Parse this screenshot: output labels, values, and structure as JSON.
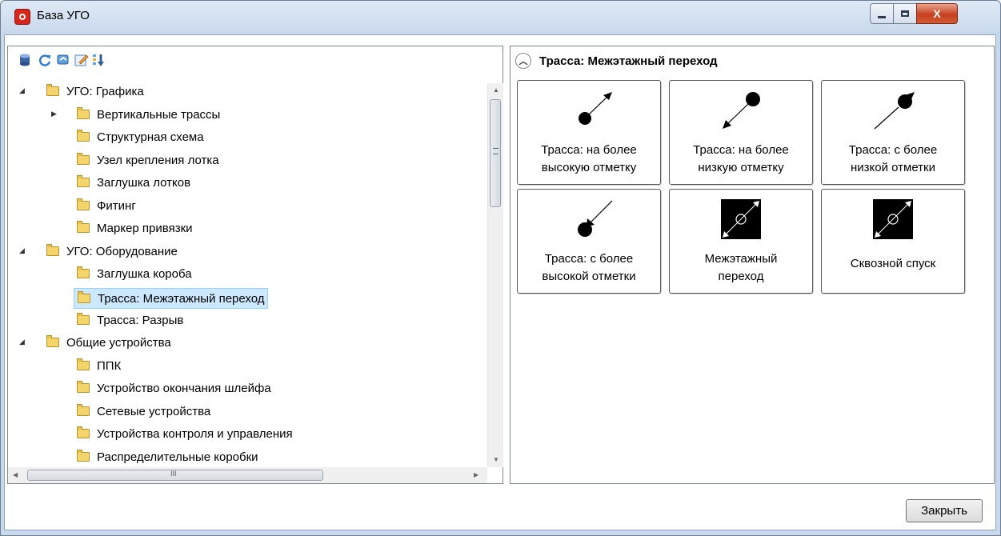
{
  "window": {
    "title": "База УГО",
    "minimize_icon": "minimize-icon",
    "maximize_icon": "maximize-icon",
    "close_glyph": "X"
  },
  "toolbar": {
    "icons": [
      "database-icon",
      "refresh-icon",
      "sync-icon",
      "edit-icon",
      "sort-icon"
    ]
  },
  "tree": {
    "items": [
      {
        "label": "УГО: Графика",
        "level": 0,
        "expanded": true
      },
      {
        "label": "Вертикальные трассы",
        "level": 1,
        "collapsed": true
      },
      {
        "label": "Структурная схема",
        "level": 1
      },
      {
        "label": "Узел крепления лотка",
        "level": 1
      },
      {
        "label": "Заглушка лотков",
        "level": 1
      },
      {
        "label": "Фитинг",
        "level": 1
      },
      {
        "label": "Маркер привязки",
        "level": 1
      },
      {
        "label": "УГО: Оборудование",
        "level": 0,
        "expanded": true
      },
      {
        "label": "Заглушка короба",
        "level": 1
      },
      {
        "label": "Трасса: Межэтажный переход",
        "level": 1,
        "selected": true
      },
      {
        "label": "Трасса: Разрыв",
        "level": 1
      },
      {
        "label": "Общие устройства",
        "level": 0,
        "expanded": true
      },
      {
        "label": "ППК",
        "level": 1
      },
      {
        "label": "Устройство окончания шлейфа",
        "level": 1
      },
      {
        "label": "Сетевые устройства",
        "level": 1
      },
      {
        "label": "Устройства контроля и управления",
        "level": 1
      },
      {
        "label": "Распределительные коробки",
        "level": 1
      }
    ]
  },
  "scroll": {
    "hthumb_grip": "III"
  },
  "gallery": {
    "group_title": "Трасса: Межэтажный переход",
    "tiles": [
      {
        "line1": "Трасса: на более",
        "line2": "высокую отметку",
        "icon": "trace-up-arrow-icon"
      },
      {
        "line1": "Трасса: на более",
        "line2": "низкую отметку",
        "icon": "trace-down-arrow-icon"
      },
      {
        "line1": "Трасса: с более",
        "line2": "низкой отметки",
        "icon": "trace-from-lower-icon"
      },
      {
        "line1": "Трасса: с более",
        "line2": "высокой отметки",
        "icon": "trace-from-higher-icon"
      },
      {
        "line1": "Межэтажный",
        "line2": "переход",
        "icon": "floor-transition-icon"
      },
      {
        "line1": "Сквозной спуск",
        "line2": "",
        "icon": "through-descent-icon"
      }
    ]
  },
  "footer": {
    "close_label": "Закрыть"
  }
}
